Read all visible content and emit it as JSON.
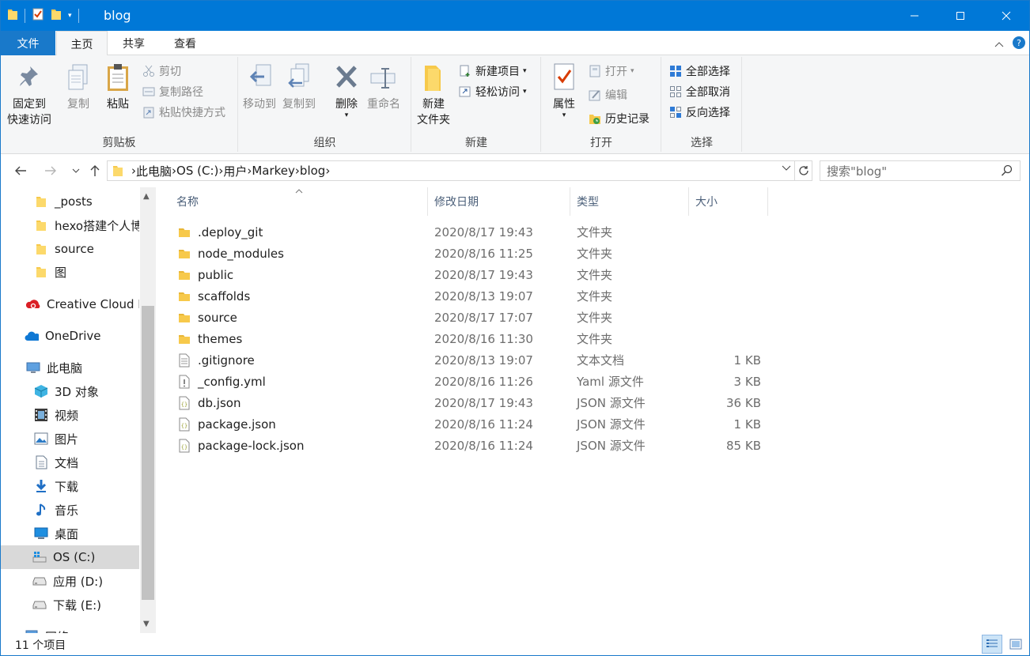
{
  "window": {
    "title": "blog"
  },
  "tabs": {
    "file": "文件",
    "home": "主页",
    "share": "共享",
    "view": "查看"
  },
  "ribbon": {
    "clipboard": {
      "label": "剪贴板",
      "pin_line1": "固定到",
      "pin_line2": "快速访问",
      "copy": "复制",
      "paste": "粘贴",
      "cut": "剪切",
      "copy_path": "复制路径",
      "paste_shortcut": "粘贴快捷方式"
    },
    "organize": {
      "label": "组织",
      "move_to": "移动到",
      "copy_to": "复制到",
      "delete": "删除",
      "rename": "重命名"
    },
    "new": {
      "label": "新建",
      "new_folder_line1": "新建",
      "new_folder_line2": "文件夹",
      "new_item": "新建项目",
      "easy_access": "轻松访问"
    },
    "open": {
      "label": "打开",
      "properties": "属性",
      "open": "打开",
      "edit": "编辑",
      "history": "历史记录"
    },
    "select": {
      "label": "选择",
      "select_all": "全部选择",
      "select_none": "全部取消",
      "invert": "反向选择"
    }
  },
  "address": {
    "crumbs": [
      "此电脑",
      "OS (C:)",
      "用户",
      "Markey",
      "blog"
    ],
    "search_placeholder": "搜索\"blog\""
  },
  "nav": {
    "items": [
      {
        "label": "_posts",
        "icon": "folder-icon"
      },
      {
        "label": "hexo搭建个人博客",
        "icon": "folder-icon"
      },
      {
        "label": "source",
        "icon": "folder-icon"
      },
      {
        "label": "图",
        "icon": "folder-icon"
      },
      {
        "label": "Creative Cloud Files",
        "icon": "creative-cloud-icon"
      },
      {
        "label": "OneDrive",
        "icon": "onedrive-icon"
      },
      {
        "label": "此电脑",
        "icon": "this-pc-icon"
      },
      {
        "label": "3D 对象",
        "icon": "3d-objects-icon"
      },
      {
        "label": "视频",
        "icon": "videos-icon"
      },
      {
        "label": "图片",
        "icon": "pictures-icon"
      },
      {
        "label": "文档",
        "icon": "documents-icon"
      },
      {
        "label": "下载",
        "icon": "downloads-icon"
      },
      {
        "label": "音乐",
        "icon": "music-icon"
      },
      {
        "label": "桌面",
        "icon": "desktop-icon"
      },
      {
        "label": "OS (C:)",
        "icon": "drive-c-icon"
      },
      {
        "label": "应用 (D:)",
        "icon": "drive-icon"
      },
      {
        "label": "下载 (E:)",
        "icon": "drive-icon"
      },
      {
        "label": "网络",
        "icon": "network-icon"
      }
    ]
  },
  "columns": {
    "name": "名称",
    "date": "修改日期",
    "type": "类型",
    "size": "大小"
  },
  "files": [
    {
      "name": ".deploy_git",
      "date": "2020/8/17 19:43",
      "type": "文件夹",
      "size": "",
      "icon": "folder-icon"
    },
    {
      "name": "node_modules",
      "date": "2020/8/16 11:25",
      "type": "文件夹",
      "size": "",
      "icon": "folder-icon"
    },
    {
      "name": "public",
      "date": "2020/8/17 19:43",
      "type": "文件夹",
      "size": "",
      "icon": "folder-icon"
    },
    {
      "name": "scaffolds",
      "date": "2020/8/13 19:07",
      "type": "文件夹",
      "size": "",
      "icon": "folder-icon"
    },
    {
      "name": "source",
      "date": "2020/8/17 17:07",
      "type": "文件夹",
      "size": "",
      "icon": "folder-icon"
    },
    {
      "name": "themes",
      "date": "2020/8/16 11:30",
      "type": "文件夹",
      "size": "",
      "icon": "folder-icon"
    },
    {
      "name": ".gitignore",
      "date": "2020/8/13 19:07",
      "type": "文本文档",
      "size": "1 KB",
      "icon": "text-file-icon"
    },
    {
      "name": "_config.yml",
      "date": "2020/8/16 11:26",
      "type": "Yaml 源文件",
      "size": "3 KB",
      "icon": "yaml-file-icon"
    },
    {
      "name": "db.json",
      "date": "2020/8/17 19:43",
      "type": "JSON 源文件",
      "size": "36 KB",
      "icon": "json-file-icon"
    },
    {
      "name": "package.json",
      "date": "2020/8/16 11:24",
      "type": "JSON 源文件",
      "size": "1 KB",
      "icon": "json-file-icon"
    },
    {
      "name": "package-lock.json",
      "date": "2020/8/16 11:24",
      "type": "JSON 源文件",
      "size": "85 KB",
      "icon": "json-file-icon"
    }
  ],
  "status": {
    "count": "11 个项目"
  },
  "colors": {
    "accent": "#0078d7",
    "folder": "#f7c94b",
    "ribbon_bg": "#f5f6f7",
    "selected_nav": "#d9d9d9"
  }
}
